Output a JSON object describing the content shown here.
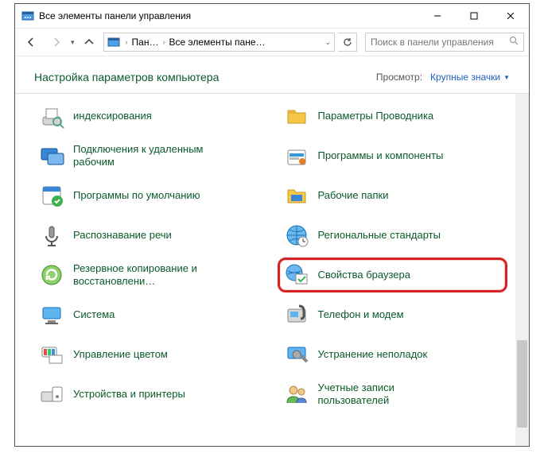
{
  "window": {
    "title": "Все элементы панели управления"
  },
  "breadcrumbs": {
    "root": "Пан…",
    "current": "Все элементы пане…"
  },
  "search": {
    "placeholder": "Поиск в панели управления"
  },
  "header": {
    "title": "Настройка параметров компьютера"
  },
  "view": {
    "label": "Просмотр:",
    "value": "Крупные значки"
  },
  "items": {
    "left": [
      {
        "icon": "indexing",
        "label": "индексирования"
      },
      {
        "icon": "remote",
        "label": "Подключения к удаленным рабочим"
      },
      {
        "icon": "defaults",
        "label": "Программы по умолчанию"
      },
      {
        "icon": "speech",
        "label": "Распознавание речи"
      },
      {
        "icon": "backup",
        "label": "Резервное копирование и восстановлени…"
      },
      {
        "icon": "system",
        "label": "Система"
      },
      {
        "icon": "color",
        "label": "Управление цветом"
      },
      {
        "icon": "devices",
        "label": "Устройства и принтеры"
      }
    ],
    "right": [
      {
        "icon": "explorer",
        "label": "Параметры Проводника"
      },
      {
        "icon": "programs",
        "label": "Программы и компоненты"
      },
      {
        "icon": "taskbar",
        "label": "Рабочие папки"
      },
      {
        "icon": "region",
        "label": "Региональные стандарты"
      },
      {
        "icon": "internet",
        "label": "Свойства браузера",
        "highlight": true
      },
      {
        "icon": "phone",
        "label": "Телефон и модем"
      },
      {
        "icon": "trouble",
        "label": "Устранение неполадок"
      },
      {
        "icon": "users",
        "label": "Учетные записи пользователей"
      }
    ]
  }
}
